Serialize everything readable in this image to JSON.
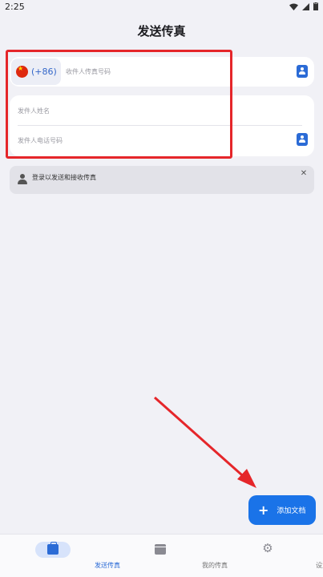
{
  "status_bar": {
    "time": "2:25"
  },
  "header": {
    "title": "发送传真"
  },
  "recipient": {
    "country_code": "(+86)",
    "fax_placeholder": "收件人传真号码"
  },
  "sender": {
    "name_placeholder": "发件人姓名",
    "phone_placeholder": "发件人电话号码"
  },
  "banner": {
    "text": "登录以发送和接收传真",
    "close_glyph": "✕"
  },
  "fab": {
    "plus": "+",
    "label": "添加文档"
  },
  "nav": {
    "items": [
      {
        "label": "发送传真",
        "active": true,
        "icon": "briefcase-icon"
      },
      {
        "label": "我的传真",
        "active": false,
        "icon": "archive-icon"
      },
      {
        "label": "设置",
        "active": false,
        "icon": "gear-icon"
      }
    ]
  },
  "colors": {
    "accent": "#1a73e8",
    "annotation": "#e5262a",
    "background": "#f1f1f6"
  }
}
